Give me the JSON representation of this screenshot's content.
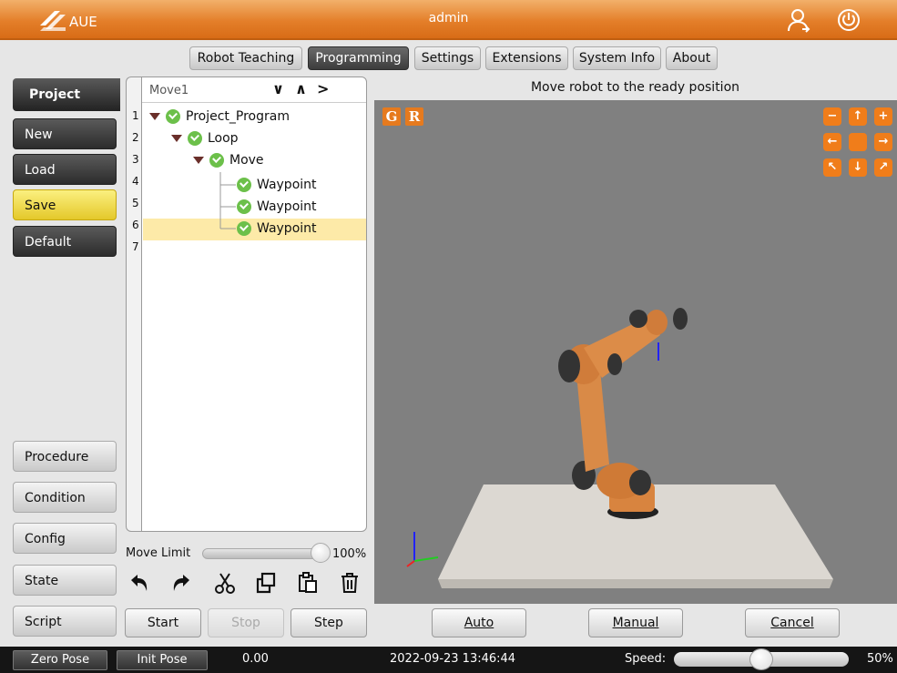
{
  "titlebar": {
    "logo_text": "AUE",
    "user": "admin",
    "user_icon": "user-icon",
    "power_icon": "power-icon",
    "accent": "#e47f2a"
  },
  "tabs": [
    {
      "label": "Robot Teaching",
      "active": false
    },
    {
      "label": "Programming",
      "active": true
    },
    {
      "label": "Settings",
      "active": false
    },
    {
      "label": "Extensions",
      "active": false
    },
    {
      "label": "System Info",
      "active": false
    },
    {
      "label": "About",
      "active": false
    }
  ],
  "sidebar": {
    "header": "Project",
    "top_items": [
      {
        "label": "New"
      },
      {
        "label": "Load"
      },
      {
        "label": "Save",
        "highlighted": true
      },
      {
        "label": "Default"
      }
    ],
    "bottom_items": [
      {
        "label": "Procedure"
      },
      {
        "label": "Condition"
      },
      {
        "label": "Config"
      },
      {
        "label": "State"
      },
      {
        "label": "Script"
      }
    ]
  },
  "tree": {
    "breadcrumb": "Move1",
    "nav": [
      "∨",
      "∧",
      ">"
    ],
    "line_numbers": [
      "1",
      "2",
      "3",
      "4",
      "5",
      "6",
      "7"
    ],
    "nodes": [
      {
        "label": "Project_Program",
        "expanded": true
      },
      {
        "label": "Loop",
        "expanded": true
      },
      {
        "label": "Move",
        "expanded": true
      },
      {
        "label": "Waypoint"
      },
      {
        "label": "Waypoint"
      },
      {
        "label": "Waypoint",
        "selected": true
      }
    ]
  },
  "move_limit": {
    "label": "Move Limit",
    "value": "100%",
    "fraction": 1.0
  },
  "toolbar_icons": [
    "undo-icon",
    "redo-icon",
    "cut-icon",
    "copy-icon",
    "paste-icon",
    "delete-icon"
  ],
  "program_buttons": {
    "start": "Start",
    "stop": "Stop",
    "step": "Step"
  },
  "viewport": {
    "instruction": "Move robot to the ready position",
    "g_label": "G",
    "r_label": "R",
    "camera_icons": [
      "zoom-out-icon",
      "up-arrow-icon",
      "zoom-in-icon",
      "left-arrow-icon",
      "center-icon",
      "right-arrow-icon",
      "rotate-left-icon",
      "down-arrow-icon",
      "rotate-right-icon"
    ]
  },
  "mode_buttons": {
    "auto": "Auto",
    "manual": "Manual",
    "cancel": "Cancel"
  },
  "statusbar": {
    "zero_pose": "Zero Pose",
    "init_pose": "Init Pose",
    "value": "0.00",
    "datetime": "2022-09-23 13:46:44",
    "speed_label": "Speed:",
    "speed_value": "50%",
    "speed_fraction": 0.5
  }
}
